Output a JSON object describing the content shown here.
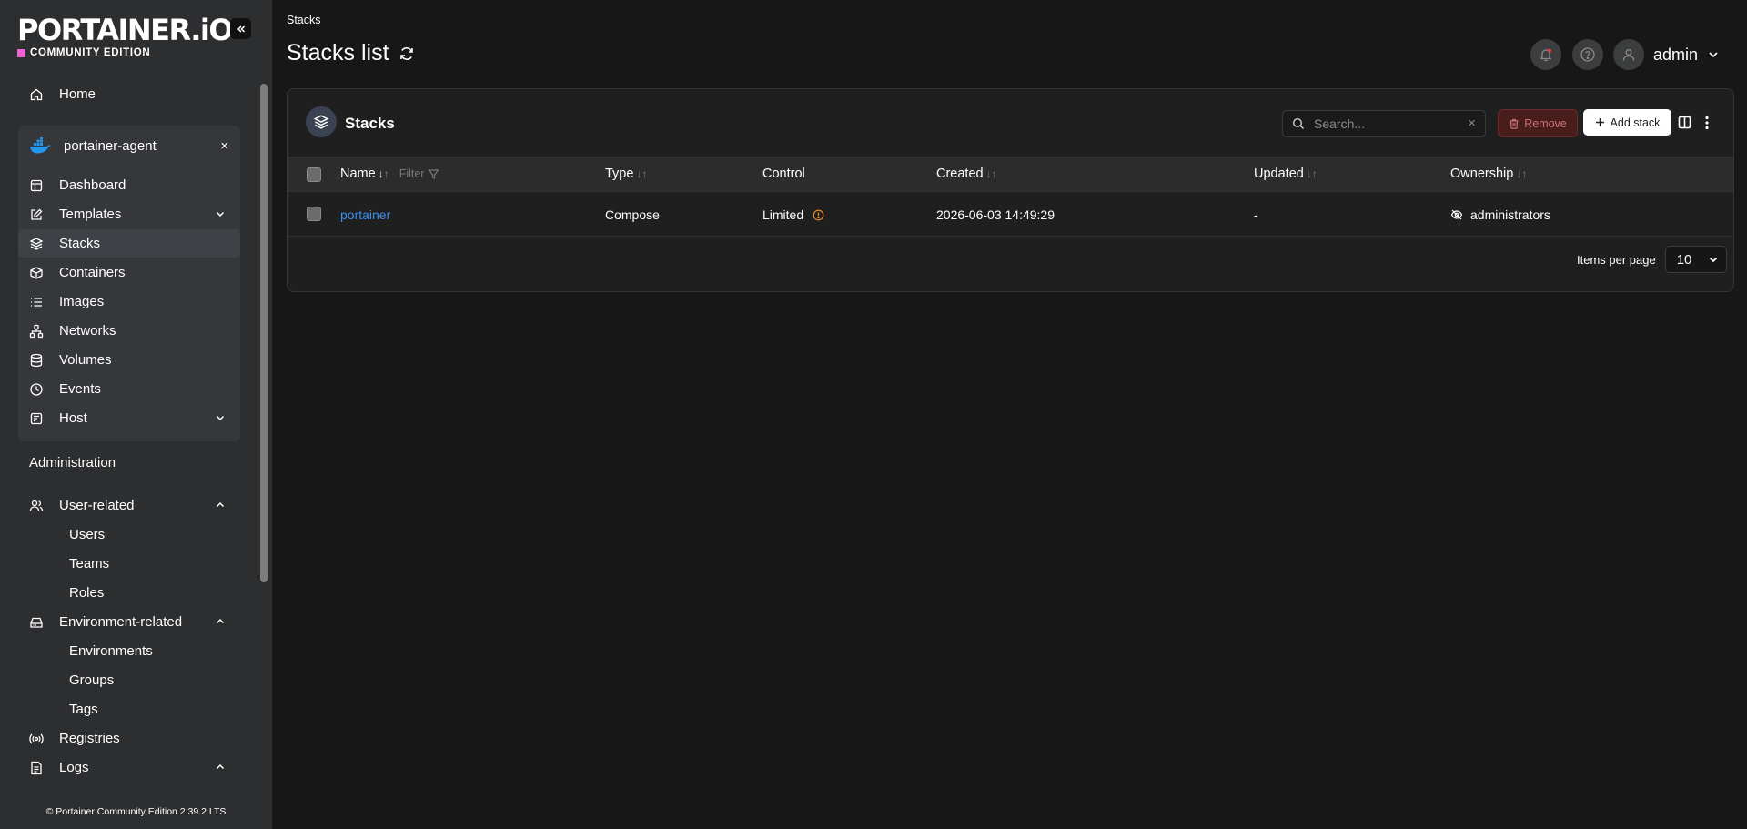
{
  "brand": {
    "logo_text": "PORTAINER.iO",
    "edition": "COMMUNITY EDITION",
    "accent": "#ec64d1"
  },
  "sidebar": {
    "home": "Home",
    "environment": {
      "name": "portainer-agent",
      "close": "×"
    },
    "env_items": [
      {
        "label": "Dashboard",
        "icon": "dashboard-icon"
      },
      {
        "label": "Templates",
        "icon": "edit-icon",
        "expandable": true
      },
      {
        "label": "Stacks",
        "icon": "layers-icon",
        "active": true
      },
      {
        "label": "Containers",
        "icon": "box-icon"
      },
      {
        "label": "Images",
        "icon": "list-icon"
      },
      {
        "label": "Networks",
        "icon": "network-icon"
      },
      {
        "label": "Volumes",
        "icon": "database-icon"
      },
      {
        "label": "Events",
        "icon": "clock-icon"
      },
      {
        "label": "Host",
        "icon": "host-icon",
        "expandable": true
      }
    ],
    "administration": {
      "title": "Administration",
      "user_related": {
        "label": "User-related",
        "children": [
          "Users",
          "Teams",
          "Roles"
        ]
      },
      "environment_related": {
        "label": "Environment-related",
        "children": [
          "Environments",
          "Groups",
          "Tags"
        ]
      },
      "registries": "Registries",
      "logs": "Logs"
    },
    "footer": "© Portainer Community Edition  2.39.2 LTS"
  },
  "header": {
    "breadcrumb": "Stacks",
    "title": "Stacks list",
    "user": "admin"
  },
  "stacks_panel": {
    "title": "Stacks",
    "search_placeholder": "Search...",
    "remove_label": "Remove",
    "add_label": "Add stack",
    "columns": {
      "name": "Name",
      "filter": "Filter",
      "type": "Type",
      "control": "Control",
      "created": "Created",
      "updated": "Updated",
      "ownership": "Ownership"
    },
    "rows": [
      {
        "name": "portainer",
        "type": "Compose",
        "control": "Limited",
        "created": "2026-06-03 14:49:29",
        "updated": "-",
        "ownership": "administrators"
      }
    ],
    "items_per_page_label": "Items per page",
    "items_per_page": "10"
  }
}
